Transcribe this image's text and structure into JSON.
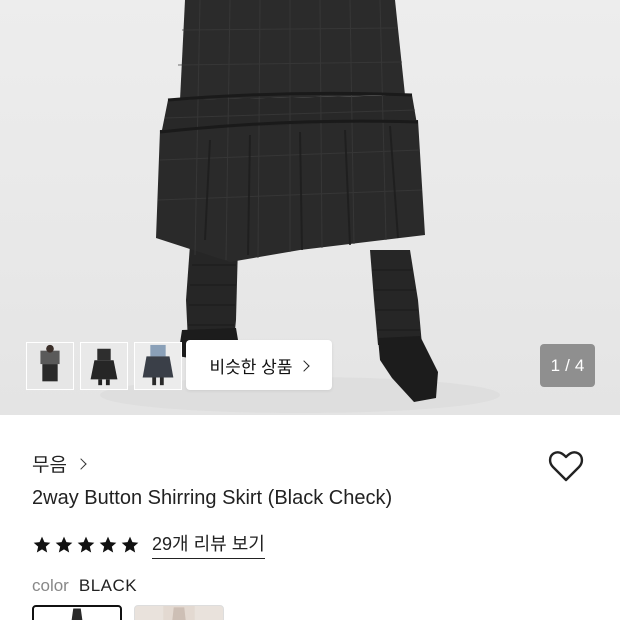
{
  "gallery": {
    "similar_label": "비슷한 상품",
    "counter_current": "1",
    "counter_sep": "/",
    "counter_total": "4",
    "thumbnails": [
      "thumb-1",
      "thumb-2",
      "thumb-3"
    ]
  },
  "product": {
    "brand": "무음",
    "title": "2way Button Shirring Skirt (Black Check)",
    "rating_stars": 5,
    "review_link": "29개 리뷰 보기",
    "color_label": "color",
    "color_value": "BLACK"
  },
  "colors": {
    "star": "#111111",
    "skirt": "#2a2a2a",
    "background": "#ebebeb"
  },
  "icons": {
    "wishlist": "heart-outline-icon",
    "chevron": "chevron-right-icon",
    "star": "star-icon"
  }
}
